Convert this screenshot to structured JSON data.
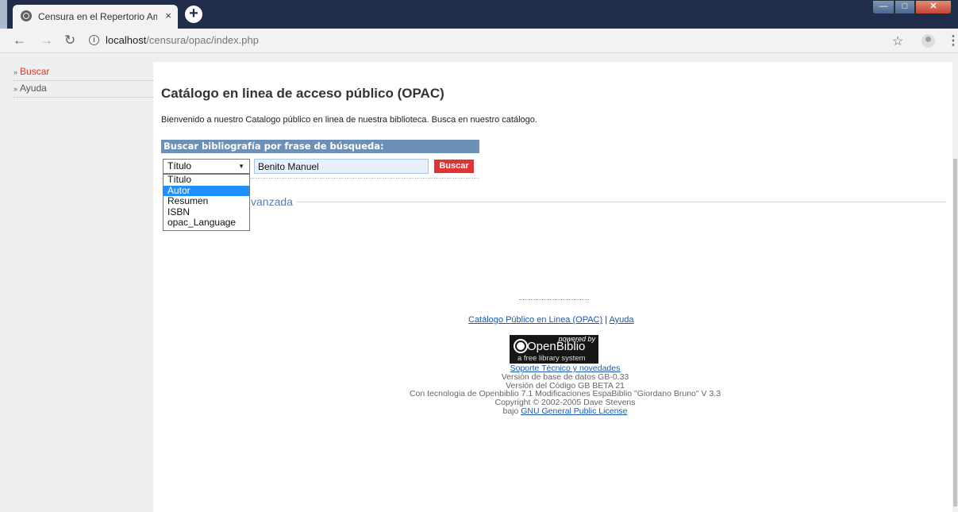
{
  "browser": {
    "tab_title": "Censura en el Repertorio Americ",
    "tab_close": "×",
    "new_tab": "+",
    "url_info": "i",
    "url_host": "localhost",
    "url_path": "/censura/opac/index.php",
    "icons": [
      "globe-icon",
      "back-icon",
      "forward-icon",
      "reload-icon",
      "info-icon",
      "star-icon",
      "profile-icon",
      "menu-icon"
    ]
  },
  "sidebar": {
    "items": [
      {
        "label": "Buscar",
        "active": true
      },
      {
        "label": "Ayuda",
        "active": false
      }
    ]
  },
  "main": {
    "title": "Catálogo en linea de acceso público (OPAC)",
    "welcome": "Bienvenido a nuestro Catalogo público en linea de nuestra biblioteca. Busca en nuestro catálogo.",
    "search_header": "Buscar bibliografía por frase de búsqueda:",
    "search_type": {
      "selected": "Título",
      "options": [
        "Título",
        "Autor",
        "Resumen",
        "ISBN",
        "opac_Language"
      ],
      "highlighted": "Autor"
    },
    "search_value": "Benito Manuel",
    "search_button": "Buscar",
    "advanced_label": "vanzada"
  },
  "footer": {
    "dashes": "--------------------------------",
    "link_opac": "Catálogo Público en Linea (OPAC)",
    "separator": "|",
    "link_help": "Ayuda",
    "logo_powered": "powered by",
    "logo_name": "OpenBiblio",
    "logo_tagline": "a free library system",
    "support_link": "Soporte Técnico y novedades",
    "db_version": "Versión de base de datos GB-0.33",
    "code_version": "Versión del Código GB BETA 21",
    "technology": "Con tecnologia de Openbiblio 7.1 Modificaciones EspaBiblio \"Giordano Bruno\" V 3.3",
    "copyright": "Copyright © 2002-2005 Dave Stevens",
    "license_prefix": "bajo",
    "license_link": "GNU General Public License"
  },
  "colors": {
    "accent_red": "#e13333",
    "header_blue": "#6d90b8",
    "link_blue": "#1a57b0",
    "selected_option": "#1e90ff"
  }
}
